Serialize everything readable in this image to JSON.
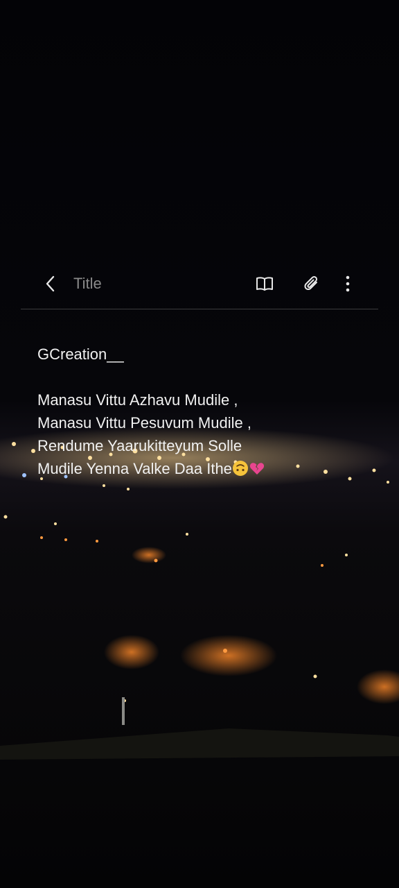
{
  "colors": {
    "background": "#050507",
    "text": "#f1f1f1",
    "placeholder": "#8a8a8a",
    "icon": "#e8e8e8",
    "divider": "#3d3d3d",
    "city_light": "#ffd27a"
  },
  "toolbar": {
    "back_icon": "chevron-left-icon",
    "title_placeholder": "Title",
    "reader_icon": "book-open-icon",
    "attach_icon": "paperclip-icon",
    "more_icon": "more-vertical-icon"
  },
  "note": {
    "author": "GCreation__",
    "lines": [
      "Manasu Vittu Azhavu Mudile ,",
      "Manasu Vittu Pesuvum Mudile ,",
      "Rendume Yaarukitteyum Solle",
      "Mudile  Yenna Valke Daa Ithe"
    ],
    "emojis": [
      "upside-down-face-icon",
      "broken-heart-icon"
    ]
  }
}
